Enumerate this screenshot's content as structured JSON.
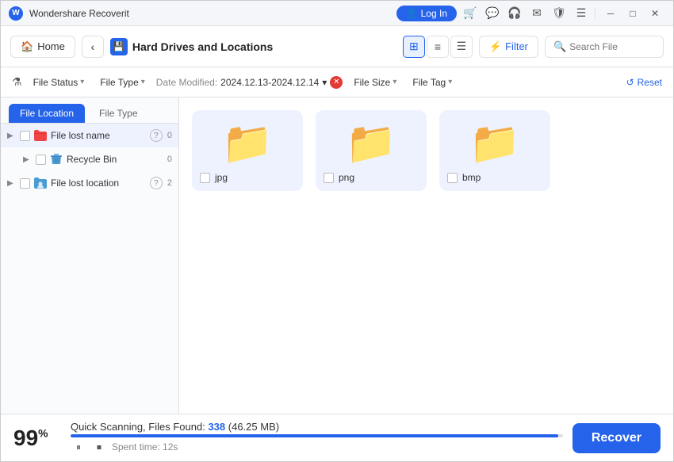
{
  "titleBar": {
    "appName": "Wondershare Recoverit",
    "loginLabel": "Log In",
    "icons": [
      "cart",
      "message",
      "headphone",
      "mail",
      "shield",
      "list"
    ]
  },
  "navBar": {
    "homeLabel": "Home",
    "backArrow": "‹",
    "currentPage": "Hard Drives and Locations",
    "filterLabel": "Filter",
    "searchPlaceholder": "Search File"
  },
  "filterBar": {
    "fileStatusLabel": "File Status",
    "fileTypeLabel": "File Type",
    "dateModifiedLabel": "Date Modified:",
    "dateModifiedValue": "2024.12.13-2024.12.14",
    "fileSizeLabel": "File Size",
    "fileTagLabel": "File Tag",
    "resetLabel": "Reset"
  },
  "sidebar": {
    "tabs": [
      {
        "label": "File Location",
        "active": true
      },
      {
        "label": "File Type",
        "active": false
      }
    ],
    "items": [
      {
        "label": "File lost name",
        "showHelp": true,
        "count": "0",
        "indent": 0
      },
      {
        "label": "Recycle Bin",
        "showHelp": false,
        "count": "0",
        "indent": 1
      },
      {
        "label": "File lost location",
        "showHelp": true,
        "count": "2",
        "indent": 0
      }
    ]
  },
  "fileGrid": {
    "items": [
      {
        "name": "jpg",
        "emoji": "📁"
      },
      {
        "name": "png",
        "emoji": "📁"
      },
      {
        "name": "bmp",
        "emoji": "📁"
      }
    ]
  },
  "bottomBar": {
    "percentage": "99",
    "percentSign": "%",
    "scanLabel": "Quick Scanning, Files Found:",
    "fileCount": "338",
    "fileSize": "(46.25 MB)",
    "spentLabel": "Spent time:",
    "spentTime": "12s",
    "recoverLabel": "Recover"
  }
}
